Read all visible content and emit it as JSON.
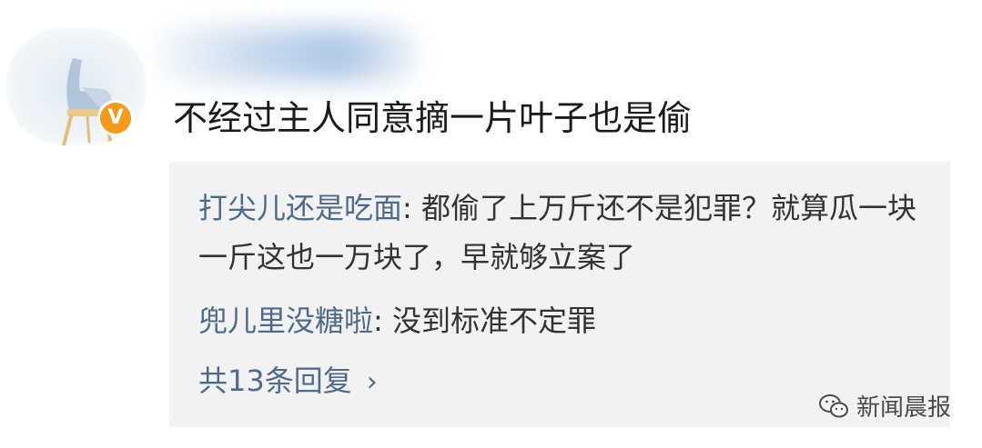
{
  "comment": {
    "text": "不经过主人同意摘一片叶子也是偷",
    "badge": "V"
  },
  "replies": [
    {
      "author": "打尖儿还是吃面",
      "separator": ": ",
      "text": "都偷了上万斤还不是犯罪？就算瓜一块一斤这也一万块了，早就够立案了"
    },
    {
      "author": "兜儿里没糖啦",
      "separator": ": ",
      "text": "没到标准不定罪"
    }
  ],
  "more_replies": {
    "label": "共13条回复",
    "chevron": "›"
  },
  "watermark": {
    "icon": "wechat-icon",
    "text": "新闻晨报"
  },
  "colors": {
    "author_link": "#4d6b8f",
    "reply_bg": "#f2f2f2",
    "badge": "#f59a1b"
  }
}
